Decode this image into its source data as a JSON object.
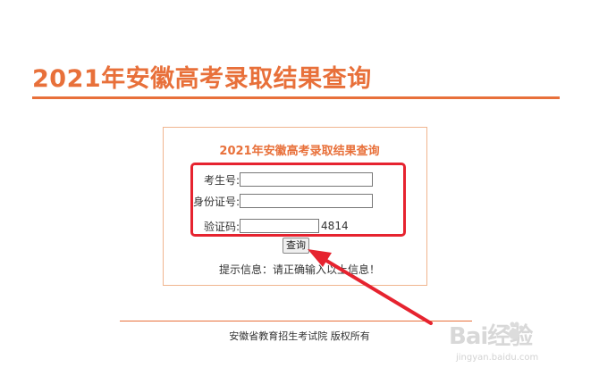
{
  "header": {
    "title": "2021年安徽高考录取结果查询"
  },
  "form": {
    "title": "2021年安徽高考录取结果查询",
    "exam_no_label": "考生号:",
    "exam_no_value": "",
    "id_no_label": "身份证号:",
    "id_no_value": "",
    "captcha_label": "验证码:",
    "captcha_value": "",
    "captcha_code": "4814",
    "submit_label": "查询",
    "hint": "提示信息：请正确输入以上信息！"
  },
  "footer": {
    "text": "安徽省教育招生考试院 版权所有"
  },
  "watermark": {
    "logo": "Bai经验",
    "url": "jingyan.baidu.com"
  },
  "colors": {
    "accent": "#e8703a",
    "annotation_red": "#e6232f",
    "box_border": "#f0b58f"
  },
  "icons": {
    "annotation": "arrow-annotation-icon",
    "watermark_paw": "baidu-paw-icon"
  }
}
